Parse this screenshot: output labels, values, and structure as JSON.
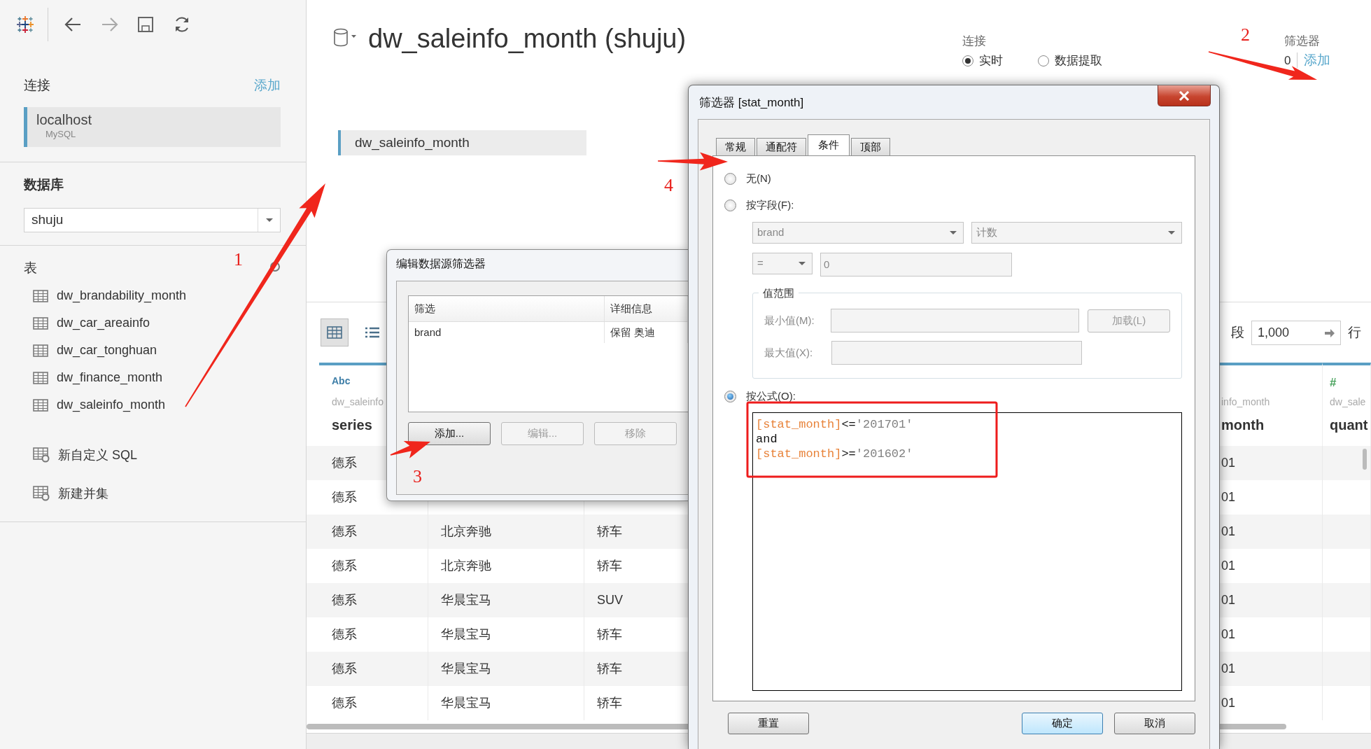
{
  "sidebar": {
    "connections_title": "连接",
    "add_connection": "添加",
    "connections": [
      {
        "name": "localhost",
        "type": "MySQL",
        "selected": true
      }
    ],
    "database_title": "数据库",
    "database": "shuju",
    "tables_title": "表",
    "tables": [
      "dw_brandability_month",
      "dw_car_areainfo",
      "dw_car_tonghuan",
      "dw_finance_month",
      "dw_saleinfo_month"
    ],
    "actions": [
      "新自定义 SQL",
      "新建并集"
    ]
  },
  "header": {
    "title": "dw_saleinfo_month (shuju)",
    "connection_title": "连接",
    "connection_options": [
      {
        "label": "实时",
        "selected": true
      },
      {
        "label": "数据提取",
        "selected": false
      }
    ],
    "filters_title": "筛选器",
    "filters_count": "0",
    "filters_add": "添加"
  },
  "canvas": {
    "tables": [
      "dw_saleinfo_month"
    ]
  },
  "grid_toolbar": {
    "views": [
      {
        "kind": "grid",
        "selected": true
      },
      {
        "kind": "list",
        "selected": false
      }
    ],
    "fields_label": "段",
    "rows_value": "1,000",
    "rows_label": "行"
  },
  "grid": {
    "columns": [
      {
        "type": "Abc",
        "source": "dw_saleinfo",
        "name": "series"
      },
      {
        "source": "info_month",
        "name": "month"
      },
      {
        "type": "#",
        "source": "dw_sale",
        "name": "quant"
      }
    ],
    "rows": [
      {
        "series": "德系",
        "month": "01"
      },
      {
        "series": "德系",
        "month": "01"
      },
      {
        "series": "德系",
        "column_2": "北京奔驰",
        "column_3": "轿车",
        "month": "01"
      },
      {
        "series": "德系",
        "column_2": "北京奔驰",
        "column_3": "轿车",
        "month": "01"
      },
      {
        "series": "德系",
        "column_2": "华晨宝马",
        "column_3": "SUV",
        "month": "01"
      },
      {
        "series": "德系",
        "column_2": "华晨宝马",
        "column_3": "轿车",
        "month": "01"
      },
      {
        "series": "德系",
        "column_2": "华晨宝马",
        "column_3": "轿车",
        "month": "01"
      },
      {
        "series": "德系",
        "column_2": "华晨宝马",
        "column_3": "轿车",
        "month": "01"
      }
    ]
  },
  "datasource_filters_dialog": {
    "title": "编辑数据源筛选器",
    "columns": [
      "筛选",
      "详细信息"
    ],
    "rows": [
      {
        "filter": "brand",
        "details": "保留 奥迪"
      }
    ],
    "buttons": [
      {
        "label": "添加...",
        "disabled": false
      },
      {
        "label": "编辑...",
        "disabled": true
      },
      {
        "label": "移除",
        "disabled": true
      }
    ]
  },
  "filter_dialog": {
    "title": "筛选器 [stat_month]",
    "tabs": [
      {
        "label": "常规",
        "selected": false
      },
      {
        "label": "通配符",
        "selected": false
      },
      {
        "label": "条件",
        "selected": true
      },
      {
        "label": "顶部",
        "selected": false
      }
    ],
    "options": [
      {
        "label": "无(N)",
        "selected": false
      },
      {
        "label": "按字段(F):",
        "selected": false
      },
      {
        "label": "按公式(O):",
        "selected": true
      }
    ],
    "by_field": {
      "disabled": true,
      "field": "brand",
      "aggregation": "计数",
      "operator": "=",
      "value": "0",
      "range_title": "值范围",
      "min_label": "最小值(M):",
      "max_label": "最大值(X):",
      "load_button": "加载(L)"
    },
    "formula": [
      [
        {
          "kind": "field",
          "text": "[stat_month]"
        },
        {
          "kind": "operator",
          "text": "<="
        },
        {
          "kind": "string",
          "text": "'201701'"
        }
      ],
      [
        {
          "kind": "keyword",
          "text": "and"
        }
      ],
      [
        {
          "kind": "field",
          "text": "[stat_month]"
        },
        {
          "kind": "operator",
          "text": ">="
        },
        {
          "kind": "string",
          "text": "'201602'"
        }
      ]
    ],
    "buttons": [
      {
        "label": "重置",
        "default": false
      },
      {
        "label": "确定",
        "default": true
      },
      {
        "label": "取消",
        "default": false
      }
    ]
  },
  "annotations": [
    {
      "label": "1"
    },
    {
      "label": "2"
    },
    {
      "label": "3"
    },
    {
      "label": "4"
    }
  ]
}
